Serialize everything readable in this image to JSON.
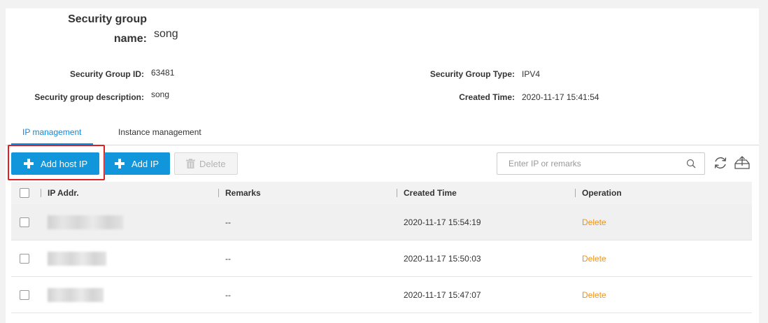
{
  "info": {
    "name_label": "Security group name:",
    "name_value": "song",
    "id_label": "Security Group ID:",
    "id_value": "63481",
    "desc_label": "Security group description:",
    "desc_value": "song",
    "type_label": "Security Group Type:",
    "type_value": "IPV4",
    "created_label": "Created Time:",
    "created_value": "2020-11-17 15:41:54"
  },
  "tabs": [
    {
      "label": "IP management",
      "active": true
    },
    {
      "label": "Instance management",
      "active": false
    }
  ],
  "toolbar": {
    "add_host_ip": "Add host IP",
    "add_ip": "Add IP",
    "delete": "Delete",
    "search_placeholder": "Enter IP or remarks"
  },
  "table": {
    "headers": [
      "IP Addr.",
      "Remarks",
      "Created Time",
      "Operation"
    ],
    "rows": [
      {
        "ip": "",
        "remarks": "--",
        "created": "2020-11-17 15:54:19",
        "operation": "Delete"
      },
      {
        "ip": "",
        "remarks": "--",
        "created": "2020-11-17 15:50:03",
        "operation": "Delete"
      },
      {
        "ip": "",
        "remarks": "--",
        "created": "2020-11-17 15:47:07",
        "operation": "Delete"
      }
    ]
  },
  "icons": {
    "search": "search-icon",
    "refresh": "refresh-icon",
    "export": "export-icon",
    "trash": "trash-icon",
    "plus": "plus-icon"
  },
  "colors": {
    "primary": "#1296db",
    "tab_active": "#0f87dc",
    "delete_link": "#f29111",
    "highlight": "#e02020"
  }
}
